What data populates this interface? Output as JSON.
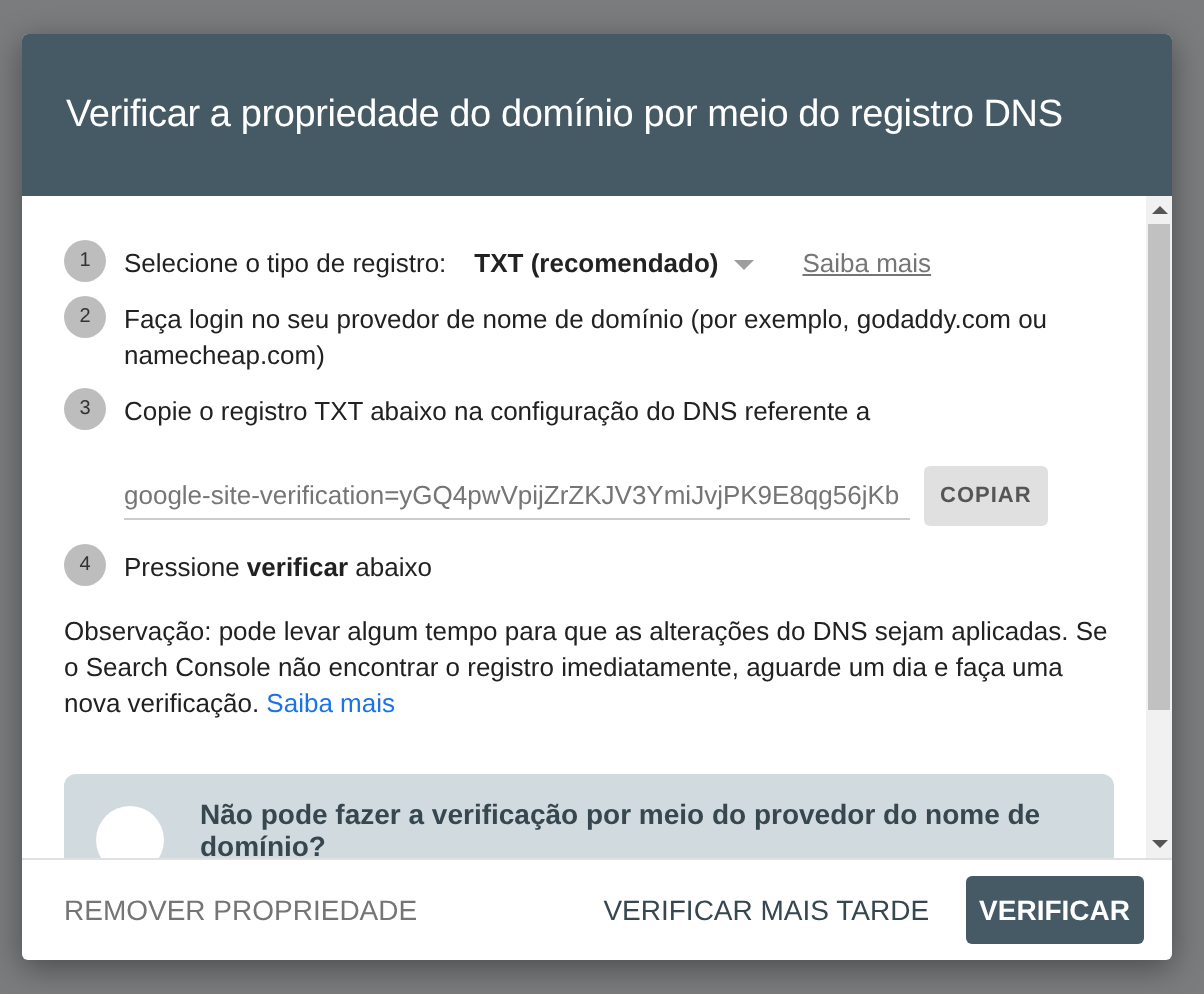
{
  "dialog": {
    "title": "Verificar a propriedade do domínio por meio do registro DNS",
    "steps": [
      {
        "number": "1",
        "kind": "select",
        "label": "Selecione o tipo de registro:",
        "value": "TXT (recomendado)",
        "link": "Saiba mais"
      },
      {
        "number": "2",
        "kind": "text",
        "label": "Faça login no seu provedor de nome de domínio (por exemplo, godaddy.com ou namecheap.com)"
      },
      {
        "number": "3",
        "kind": "copy",
        "label": "Copie o registro TXT abaixo na configuração do DNS referente a",
        "value": "google-site-verification=yGQ4pwVpijZrZKJV3YmiJvjPK9E8qg56jKb",
        "button": "COPIAR"
      },
      {
        "number": "4",
        "kind": "text",
        "label": "Pressione **verificar** abaixo"
      }
    ],
    "note": "Observação: pode levar algum tempo para que as alterações do DNS sejam aplicadas. Se o Search Console não encontrar o registro imediatamente, aguarde um dia e faça uma nova verificação.",
    "note_link": "Saiba mais",
    "alt_card": "Não pode fazer a verificação por meio do provedor do nome de domínio?",
    "buttons": [
      {
        "label": "REMOVER PROPRIEDADE",
        "kind": "flat"
      },
      {
        "label": "VERIFICAR MAIS TARDE",
        "kind": "text"
      },
      {
        "label": "VERIFICAR",
        "kind": "primary"
      }
    ]
  }
}
